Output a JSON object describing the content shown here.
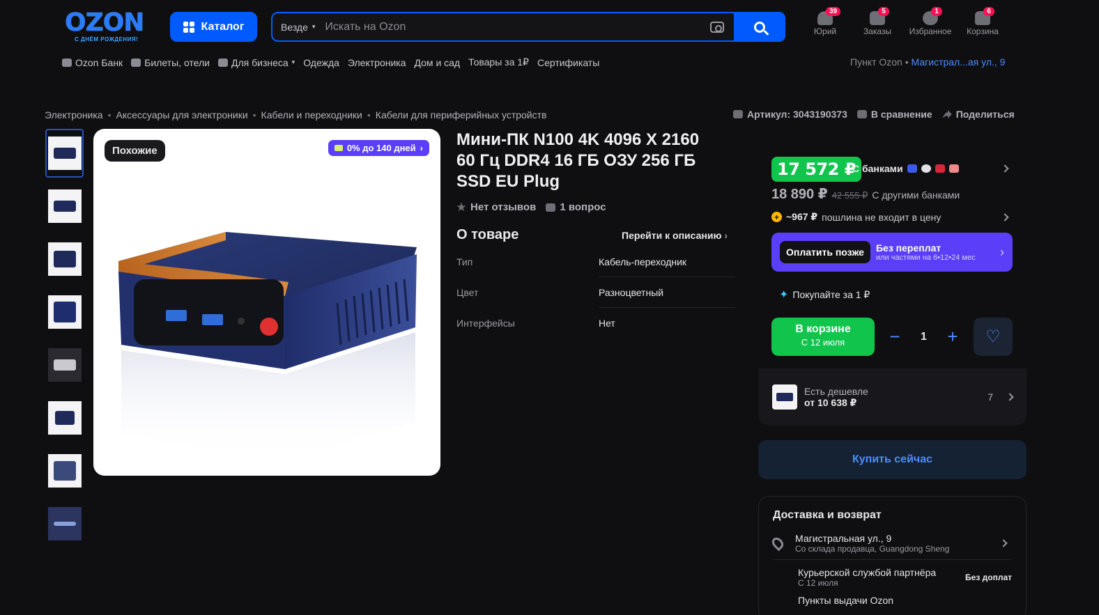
{
  "header": {
    "logo": "OZON",
    "logo_sub": "С ДНЁМ РОЖДЕНИЯ!",
    "catalog_label": "Каталог",
    "search_scope": "Везде",
    "search_placeholder": "Искать на Ozon",
    "icons": [
      {
        "label": "Юрий",
        "badge": "39",
        "icon": "user-icon"
      },
      {
        "label": "Заказы",
        "badge": "5",
        "icon": "box-icon"
      },
      {
        "label": "Избранное",
        "badge": "1",
        "icon": "heart-icon"
      },
      {
        "label": "Корзина",
        "badge": "6",
        "icon": "cart-icon"
      }
    ]
  },
  "subnav": [
    "Ozon Банк",
    "Билеты, отели",
    "Для бизнеса",
    "Одежда",
    "Электроника",
    "Дом и сад",
    "Товары за 1₽",
    "Сертификаты"
  ],
  "pickup": {
    "label": "Пункт Ozon •",
    "address": "Магистрал...ая ул., 9"
  },
  "breadcrumbs": [
    "Электроника",
    "Аксессуары для электроники",
    "Кабели и переходники",
    "Кабели для периферийных устройств"
  ],
  "meta": {
    "article": "Артикул: 3043190373",
    "compare": "В сравнение",
    "share": "Поделиться"
  },
  "image": {
    "similar": "Похожие",
    "credit": "0% до 140 дней"
  },
  "product": {
    "title": "Мини-ПК N100 4K 4096 X 2160 60 Гц DDR4 16 ГБ ОЗУ 256 ГБ SSD EU Plug",
    "reviews": "Нет отзывов",
    "questions": "1 вопрос",
    "about": "О товаре",
    "to_description": "Перейти к описанию",
    "props": [
      {
        "k": "Тип",
        "v": "Кабель-переходник"
      },
      {
        "k": "Цвет",
        "v": "Разноцветный"
      },
      {
        "k": "Интерфейсы",
        "v": "Нет"
      }
    ]
  },
  "buy": {
    "price_banks": "17 572 ₽",
    "with_banks": "С банками",
    "price_other": "18 890 ₽",
    "price_old": "42 555 ₽",
    "other_banks": "С другими банками",
    "duty_value": "~967 ₽",
    "duty_text": "пошлина не входит в цену",
    "paylater_pill": "Оплатить позже",
    "paylater_t1": "Без переплат",
    "paylater_t2": "или частями на 6•12•24 мес",
    "buy_for_1": "Покупайте за 1 ₽",
    "incart_a": "В корзине",
    "incart_b": "С 12 июля",
    "qty": "1",
    "cheaper_t1": "Есть дешевле",
    "cheaper_t2": "от 10 638 ₽",
    "cheaper_count": "7",
    "buy_now": "Купить сейчас"
  },
  "delivery": {
    "title": "Доставка и возврат",
    "address": "Магистральная ул., 9",
    "address_sub": "Со склада продавца, Guangdong Sheng",
    "courier": "Курьерской службой партнёра",
    "courier_sub": "С 12 июля",
    "courier_right": "Без доплат",
    "pvz": "Пункты выдачи Ozon"
  },
  "colors": {
    "accent": "#005bff",
    "green": "#10c44c",
    "purple": "#5a3ef8",
    "badge": "#f91155"
  }
}
